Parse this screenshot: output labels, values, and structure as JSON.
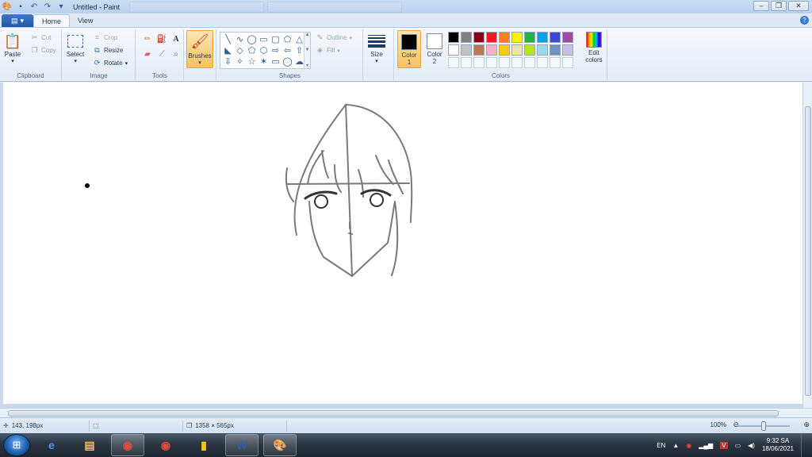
{
  "window": {
    "title": "Untitled - Paint",
    "controls": [
      "minimize",
      "restore",
      "close"
    ]
  },
  "qat": {
    "icons": [
      "paint-app-icon",
      "save-icon",
      "undo-icon",
      "redo-icon",
      "customize-qat-icon"
    ]
  },
  "ribbon": {
    "tabs": [
      {
        "label": "Home",
        "active": true
      },
      {
        "label": "View",
        "active": false
      }
    ],
    "clipboard": {
      "label": "Clipboard",
      "paste": "Paste",
      "cut": "Cut",
      "copy": "Copy"
    },
    "image": {
      "label": "Image",
      "select": "Select",
      "crop": "Crop",
      "resize": "Resize",
      "rotate": "Rotate"
    },
    "tools": {
      "label": "Tools",
      "items": [
        "pencil-icon",
        "fill-icon",
        "text-icon",
        "eraser-icon",
        "color-picker-icon",
        "magnifier-icon"
      ]
    },
    "brushes": {
      "label": "Brushes"
    },
    "shapes": {
      "label": "Shapes",
      "outline": "Outline",
      "fill": "Fill",
      "glyphs": [
        "╲",
        "∿",
        "◯",
        "▭",
        "▢",
        "⬠",
        "△",
        "◣",
        "◇",
        "⬠",
        "⬡",
        "⇨",
        "⇦",
        "⇧",
        "⇩",
        "✧",
        "☆",
        "✶",
        "▭",
        "◯",
        "☁"
      ]
    },
    "size": {
      "label": "Size"
    },
    "colors": {
      "label": "Colors",
      "color1": {
        "label_line1": "Color",
        "label_line2": "1",
        "value": "#000000"
      },
      "color2": {
        "label_line1": "Color",
        "label_line2": "2",
        "value": "#ffffff"
      },
      "palette": [
        "#000000",
        "#7f7f7f",
        "#880015",
        "#ed1c24",
        "#ff7f27",
        "#fff200",
        "#22b14c",
        "#00a2e8",
        "#3f48cc",
        "#a349a4",
        "#ffffff",
        "#c3c3c3",
        "#b97a57",
        "#ffaec9",
        "#ffc90e",
        "#efe4b0",
        "#b5e61d",
        "#99d9ea",
        "#7092be",
        "#c8bfe7",
        "",
        "",
        "",
        "",
        "",
        "",
        "",
        "",
        "",
        ""
      ],
      "edit_line1": "Edit",
      "edit_line2": "colors"
    }
  },
  "status": {
    "cursor_pos": "143, 198px",
    "canvas_size": "1358 × 565px",
    "zoom": "100%",
    "zoom_fraction": 0.5
  },
  "taskbar": {
    "apps": [
      {
        "name": "internet-explorer-icon",
        "glyph": "e",
        "color": "#3b9bff",
        "running": false
      },
      {
        "name": "file-explorer-icon",
        "glyph": "▤",
        "color": "#f2c14e",
        "running": false
      },
      {
        "name": "chrome-icon",
        "glyph": "◉",
        "color": "#e84b3c",
        "running": true
      },
      {
        "name": "chrome-icon-2",
        "glyph": "◉",
        "color": "#e84b3c",
        "running": false
      },
      {
        "name": "sticky-notes-icon",
        "glyph": "▮",
        "color": "#f5c518",
        "running": false
      },
      {
        "name": "word-icon",
        "glyph": "W",
        "color": "#2b5fb4",
        "running": true
      },
      {
        "name": "paint-icon",
        "glyph": "🎨",
        "color": "#cccccc",
        "running": true
      }
    ],
    "language": "EN",
    "time": "9:32 SA",
    "date": "18/06/2021"
  }
}
